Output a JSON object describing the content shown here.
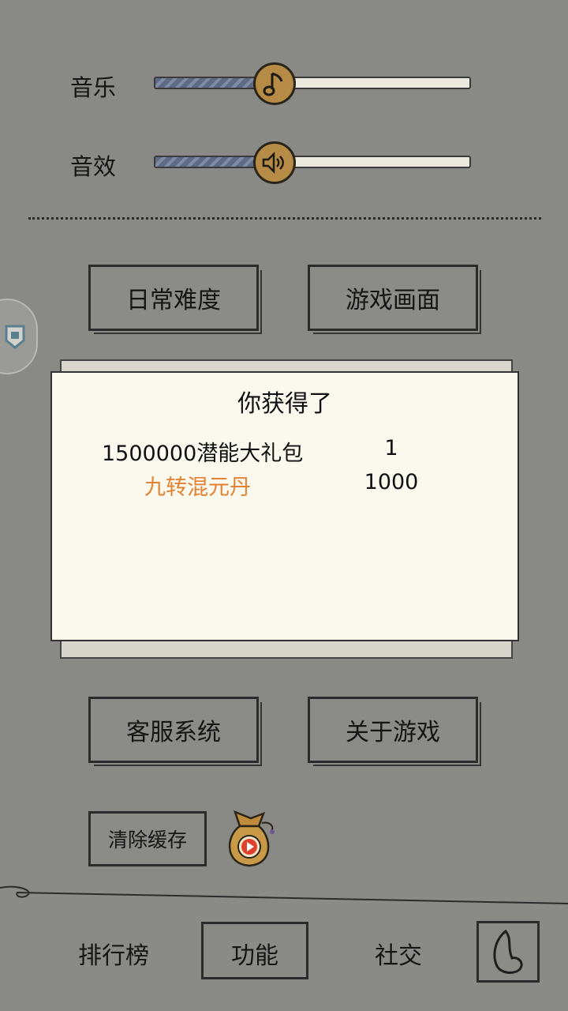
{
  "settings": {
    "music_label": "音乐",
    "music_level": 0.37,
    "sfx_label": "音效",
    "sfx_level": 0.37,
    "music_icon": "music-note-icon",
    "sfx_icon": "speaker-icon"
  },
  "buttons": {
    "daily_difficulty": "日常难度",
    "game_graphics": "游戏画面",
    "customer_service": "客服系统",
    "about_game": "关于游戏",
    "clear_cache": "清除缓存"
  },
  "reward_dialog": {
    "title": "你获得了",
    "items": [
      {
        "name": "1500000潜能大礼包",
        "qty": "1",
        "color": "#111111"
      },
      {
        "name": "九转混元丹",
        "qty": "1000",
        "color": "#e38232"
      }
    ]
  },
  "bottom_nav": {
    "ranking": "排行榜",
    "functions": "功能",
    "social": "社交"
  },
  "colors": {
    "background": "#898985",
    "knob": "#b58b45",
    "slider_fill": "#5e6a86",
    "highlight_item": "#e38232"
  }
}
